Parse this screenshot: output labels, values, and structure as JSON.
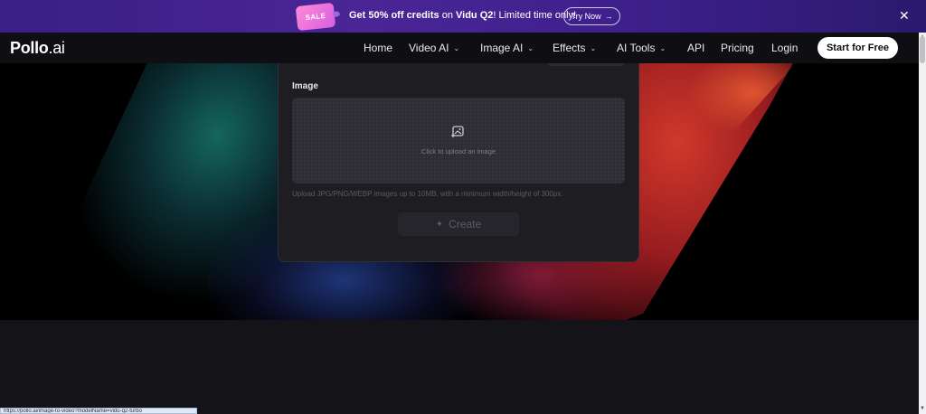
{
  "promo": {
    "badge": "SALE",
    "text_lead": "Get 50% off credits",
    "text_on": " on ",
    "text_model": "Vidu Q2",
    "text_tail": "! Limited time only!",
    "try_now": "Try Now",
    "arrow": "→",
    "close": "✕"
  },
  "nav": {
    "logo_main": "Pollo",
    "logo_suffix": ".ai",
    "items": [
      {
        "label": "Home",
        "dropdown": false
      },
      {
        "label": "Video AI",
        "dropdown": true
      },
      {
        "label": "Image AI",
        "dropdown": true
      },
      {
        "label": "Effects",
        "dropdown": true
      },
      {
        "label": "AI Tools",
        "dropdown": true
      },
      {
        "label": "API",
        "dropdown": false
      },
      {
        "label": "Pricing",
        "dropdown": false
      },
      {
        "label": "Login",
        "dropdown": false
      }
    ],
    "start_button": "Start for Free",
    "chevron": "⌄"
  },
  "panel": {
    "image_label": "Image",
    "upload_hint": "Click to upload an image",
    "upload_note": "Upload JPG/PNG/WEBP images up to 10MB, with a minimum width/height of 300px.",
    "create_label": "Create",
    "create_icon": "✦"
  },
  "status_bar": {
    "url": "https://pollo.ai/image-to-video?modelName=vidu-q2-turbo"
  },
  "colors": {
    "promo_bg": "#3a1f86",
    "nav_bg": "#0f0f13",
    "panel_bg": "#1d1d22",
    "upload_bg": "#2e2d36",
    "start_button_bg": "#ffffff"
  }
}
